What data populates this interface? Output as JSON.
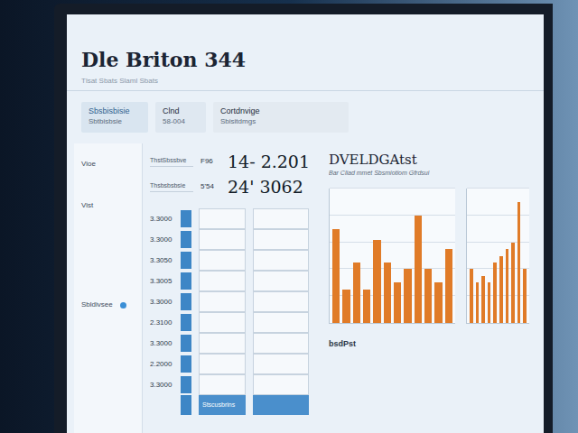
{
  "header": {
    "title": "Dle Briton 344",
    "subtitle": "Tlsat Sbats  Slaml Sbats"
  },
  "cards": [
    {
      "label": "Sbsbisbisie",
      "value": "Sbtbisbsie"
    },
    {
      "label": "Clnd",
      "value": "58-004"
    },
    {
      "label": "Cortdnvige",
      "value": "Sbisitdmgs"
    }
  ],
  "sidebar": {
    "items": [
      {
        "label": "Vioe",
        "kind": "plain"
      },
      {
        "label": "Vist",
        "kind": "plain"
      },
      {
        "label": "Sbldivsee",
        "kind": "dot"
      }
    ]
  },
  "stats": {
    "rows": [
      {
        "label": "ThstSbssbve",
        "code": "F96",
        "value": "14- 2.201"
      },
      {
        "label": "Thsbsbsbsie",
        "code": "5'54",
        "value": "24' 3062"
      }
    ]
  },
  "table": {
    "rows": [
      "3.3000",
      "3.3000",
      "3.3050",
      "3.3005",
      "3.3000",
      "2.3100",
      "3.3000",
      "2.2000",
      "3.3000"
    ],
    "footer": "Stscusbrins"
  },
  "chart": {
    "title": "DVELDGAtst",
    "subtitle": "Bar Cliad mmet Sbsmiotiom Gfrdsui",
    "bars": [
      70,
      25,
      45,
      25,
      62,
      45,
      30,
      40,
      80,
      40,
      30,
      55
    ],
    "bars2": [
      40,
      30,
      35,
      30,
      45,
      50,
      55,
      60,
      90,
      40
    ],
    "footer": "bsdPst"
  }
}
